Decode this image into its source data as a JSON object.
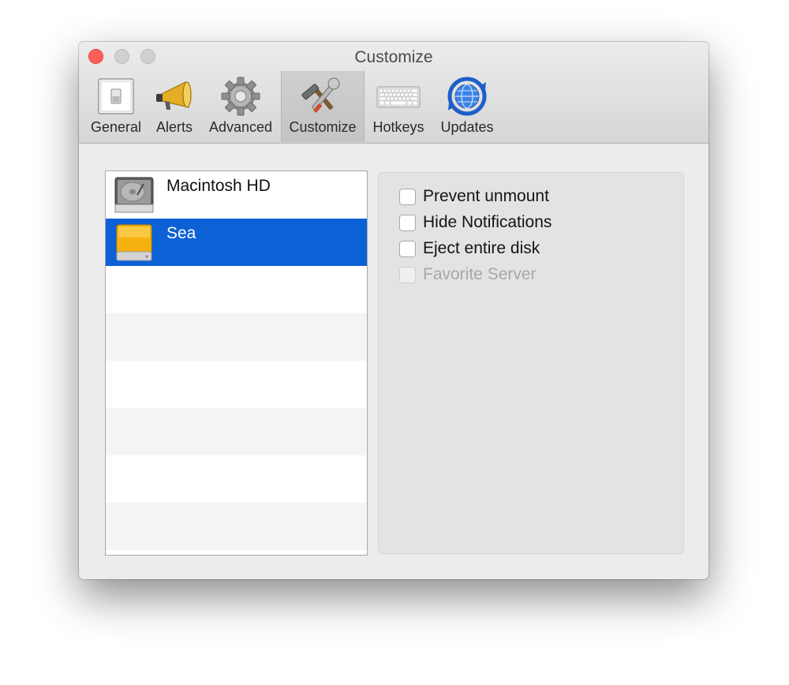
{
  "window": {
    "title": "Customize"
  },
  "toolbar": {
    "items": [
      {
        "label": "General",
        "icon": "switch-icon",
        "selected": false
      },
      {
        "label": "Alerts",
        "icon": "megaphone-icon",
        "selected": false
      },
      {
        "label": "Advanced",
        "icon": "gear-icon",
        "selected": false
      },
      {
        "label": "Customize",
        "icon": "hammer-wrench-icon",
        "selected": true
      },
      {
        "label": "Hotkeys",
        "icon": "keyboard-icon",
        "selected": false
      },
      {
        "label": "Updates",
        "icon": "globe-sync-icon",
        "selected": false
      }
    ]
  },
  "disks": {
    "items": [
      {
        "name": "Macintosh HD",
        "icon": "internal-hard-drive-icon",
        "selected": false
      },
      {
        "name": "Sea",
        "icon": "external-drive-icon",
        "selected": true
      }
    ],
    "colors": {
      "selection": "#0c61d6",
      "external_drive": "#f5b10e"
    }
  },
  "options": {
    "items": [
      {
        "label": "Prevent unmount",
        "checked": false,
        "enabled": true
      },
      {
        "label": "Hide Notifications",
        "checked": false,
        "enabled": true
      },
      {
        "label": "Eject entire disk",
        "checked": false,
        "enabled": true
      },
      {
        "label": "Favorite Server",
        "checked": false,
        "enabled": false
      }
    ]
  },
  "colors": {
    "close_button": "#fc5f57",
    "accent": "#0c61d6"
  }
}
